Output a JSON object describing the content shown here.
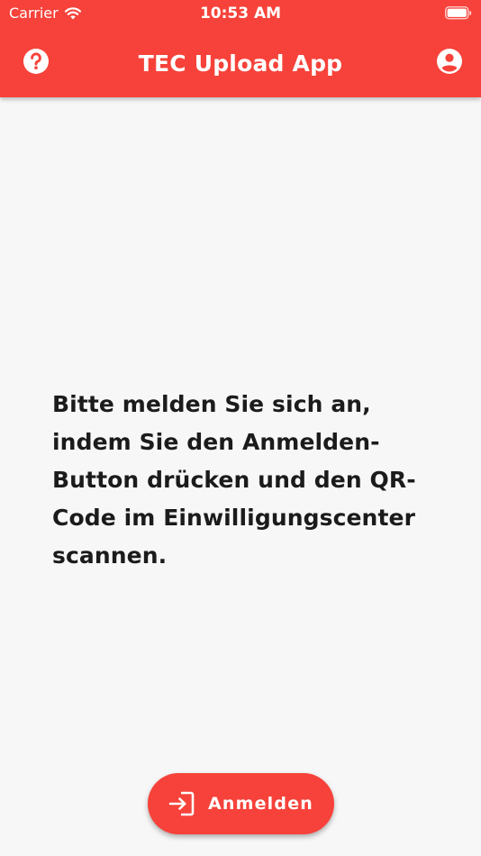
{
  "status_bar": {
    "carrier": "Carrier",
    "time": "10:53 AM",
    "wifi_icon": "wifi-icon",
    "battery_icon": "battery-icon"
  },
  "app_bar": {
    "title": "TEC Upload App",
    "help_icon": "help-circle-icon",
    "account_icon": "account-circle-icon",
    "background_color": "#f6423a"
  },
  "main": {
    "message": "Bitte melden Sie sich an, indem Sie den Anmelden-Button drücken und den QR-Code im Einwilligungscenter scannen."
  },
  "fab": {
    "label": "Anmelden",
    "icon": "login-icon",
    "background_color": "#f6423a"
  }
}
